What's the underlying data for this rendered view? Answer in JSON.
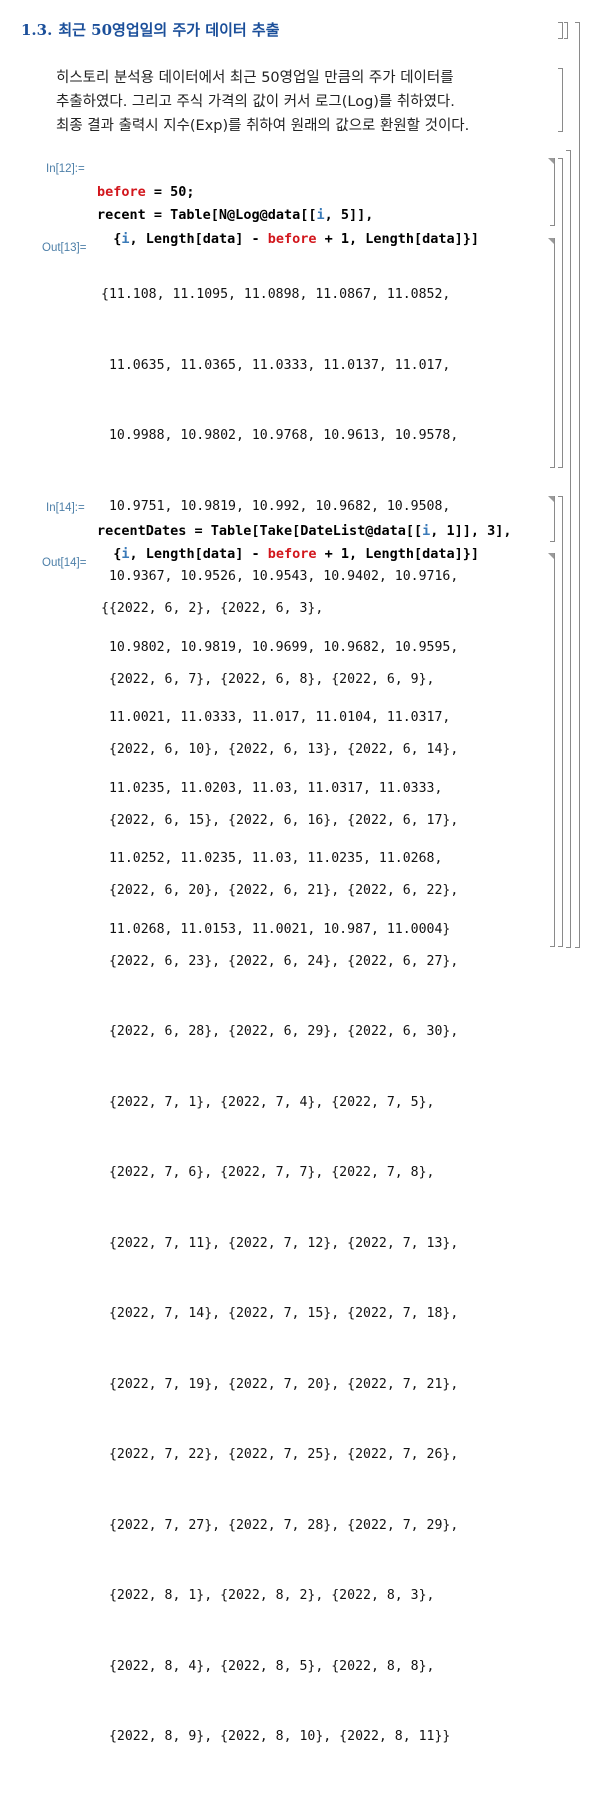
{
  "section": {
    "number": "1.3.",
    "title": "최근 50영업일의 주가 데이터 추출"
  },
  "text_cell": {
    "lines": [
      "히스토리 분석용 데이터에서 최근 50영업일 만큼의 주가 데이터를",
      "추출하였다. 그리고 주식 가격의 값이 커서 로그(Log)를 취하였다.",
      "최종 결과 출력시 지수(Exp)를 취하여 원래의 값으로 환원할 것이다."
    ]
  },
  "cell1": {
    "in_label": "In[12]:=",
    "code": {
      "line1_var": "before",
      "line1_rest": " = 50;",
      "line2_var": "recent",
      "line2_rest": " = Table[N@Log@data[[",
      "line2_i": "i",
      "line2_end": ", 5]],",
      "line3_open": "{",
      "line3_i": "i",
      "line3_mid": ", Length[data] - ",
      "line3_before": "before",
      "line3_end": " + 1, Length[data]}]"
    },
    "out_label": "Out[13]=",
    "output_lines": [
      "{11.108, 11.1095, 11.0898, 11.0867, 11.0852,",
      " 11.0635, 11.0365, 11.0333, 11.0137, 11.017,",
      " 10.9988, 10.9802, 10.9768, 10.9613, 10.9578,",
      " 10.9751, 10.9819, 10.992, 10.9682, 10.9508,",
      " 10.9367, 10.9526, 10.9543, 10.9402, 10.9716,",
      " 10.9802, 10.9819, 10.9699, 10.9682, 10.9595,",
      " 11.0021, 11.0333, 11.017, 11.0104, 11.0317,",
      " 11.0235, 11.0203, 11.03, 11.0317, 11.0333,",
      " 11.0252, 11.0235, 11.03, 11.0235, 11.0268,",
      " 11.0268, 11.0153, 11.0021, 10.987, 11.0004}"
    ]
  },
  "cell2": {
    "in_label": "In[14]:=",
    "code": {
      "line1_var": "recentDates",
      "line1_rest": " = Table[Take[DateList@data[[",
      "line1_i": "i",
      "line1_end": ", 1]], 3],",
      "line2_open": "{",
      "line2_i": "i",
      "line2_mid": ", Length[data] - ",
      "line2_before": "before",
      "line2_end": " + 1, Length[data]}]"
    },
    "out_label": "Out[14]=",
    "output_lines": [
      "{{2022, 6, 2}, {2022, 6, 3},",
      " {2022, 6, 7}, {2022, 6, 8}, {2022, 6, 9},",
      " {2022, 6, 10}, {2022, 6, 13}, {2022, 6, 14},",
      " {2022, 6, 15}, {2022, 6, 16}, {2022, 6, 17},",
      " {2022, 6, 20}, {2022, 6, 21}, {2022, 6, 22},",
      " {2022, 6, 23}, {2022, 6, 24}, {2022, 6, 27},",
      " {2022, 6, 28}, {2022, 6, 29}, {2022, 6, 30},",
      " {2022, 7, 1}, {2022, 7, 4}, {2022, 7, 5},",
      " {2022, 7, 6}, {2022, 7, 7}, {2022, 7, 8},",
      " {2022, 7, 11}, {2022, 7, 12}, {2022, 7, 13},",
      " {2022, 7, 14}, {2022, 7, 15}, {2022, 7, 18},",
      " {2022, 7, 19}, {2022, 7, 20}, {2022, 7, 21},",
      " {2022, 7, 22}, {2022, 7, 25}, {2022, 7, 26},",
      " {2022, 7, 27}, {2022, 7, 28}, {2022, 7, 29},",
      " {2022, 8, 1}, {2022, 8, 2}, {2022, 8, 3},",
      " {2022, 8, 4}, {2022, 8, 5}, {2022, 8, 8},",
      " {2022, 8, 9}, {2022, 8, 10}, {2022, 8, 11}}"
    ]
  },
  "colors": {
    "section_title": "#1b4f9a",
    "cell_label": "#4d7fa8",
    "variable_red": "#d2161c",
    "iterator_blue": "#3a7ab8",
    "cell_bracket": "#8a8a8a"
  }
}
